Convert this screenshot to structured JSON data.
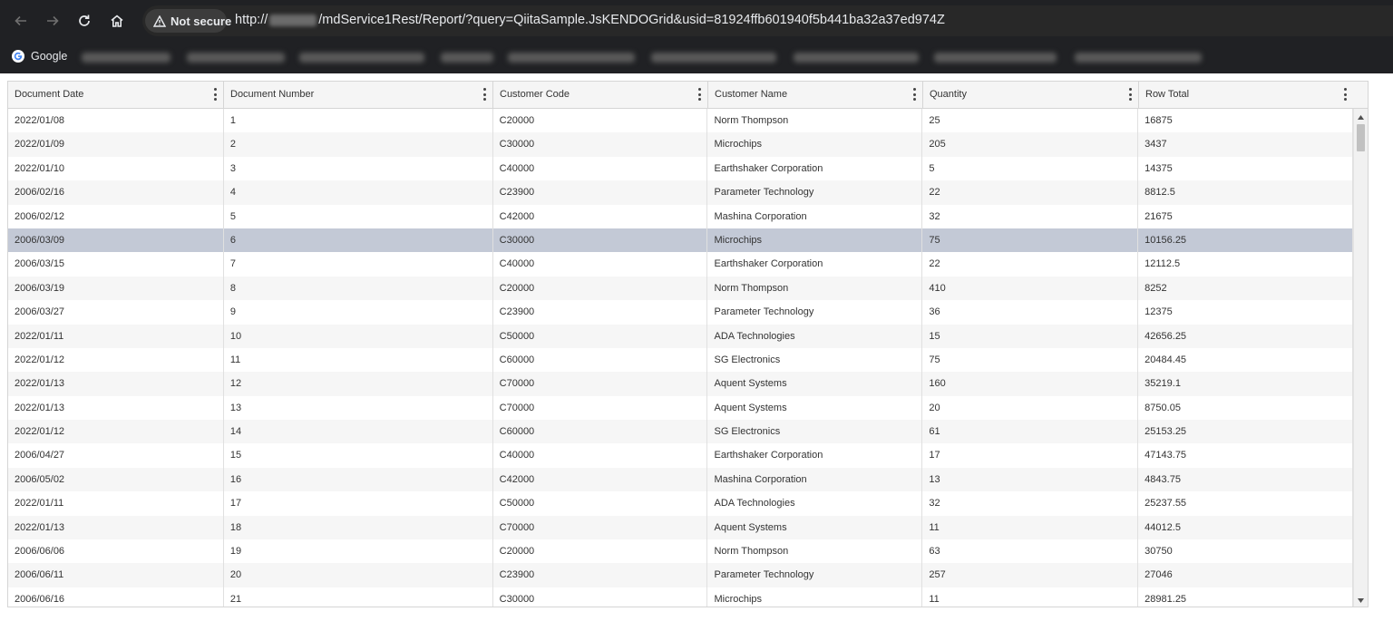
{
  "browser": {
    "security_label": "Not secure",
    "url_prefix": "http://",
    "url_suffix": "/mdService1Rest/Report/?query=QiitaSample.JsKENDOGrid&usid=81924ffb601940f5b441ba32a37ed974Z",
    "bookmark_google": "Google"
  },
  "grid": {
    "columns": [
      "Document Date",
      "Document Number",
      "Customer Code",
      "Customer Name",
      "Quantity",
      "Row Total"
    ],
    "selected_row": 6,
    "rows": [
      [
        "2022/01/08",
        "1",
        "C20000",
        "Norm Thompson",
        "25",
        "16875"
      ],
      [
        "2022/01/09",
        "2",
        "C30000",
        "Microchips",
        "205",
        "3437"
      ],
      [
        "2022/01/10",
        "3",
        "C40000",
        "Earthshaker Corporation",
        "5",
        "14375"
      ],
      [
        "2006/02/16",
        "4",
        "C23900",
        "Parameter Technology",
        "22",
        "8812.5"
      ],
      [
        "2006/02/12",
        "5",
        "C42000",
        "Mashina Corporation",
        "32",
        "21675"
      ],
      [
        "2006/03/09",
        "6",
        "C30000",
        "Microchips",
        "75",
        "10156.25"
      ],
      [
        "2006/03/15",
        "7",
        "C40000",
        "Earthshaker Corporation",
        "22",
        "12112.5"
      ],
      [
        "2006/03/19",
        "8",
        "C20000",
        "Norm Thompson",
        "410",
        "8252"
      ],
      [
        "2006/03/27",
        "9",
        "C23900",
        "Parameter Technology",
        "36",
        "12375"
      ],
      [
        "2022/01/11",
        "10",
        "C50000",
        "ADA Technologies",
        "15",
        "42656.25"
      ],
      [
        "2022/01/12",
        "11",
        "C60000",
        "SG Electronics",
        "75",
        "20484.45"
      ],
      [
        "2022/01/13",
        "12",
        "C70000",
        "Aquent Systems",
        "160",
        "35219.1"
      ],
      [
        "2022/01/13",
        "13",
        "C70000",
        "Aquent Systems",
        "20",
        "8750.05"
      ],
      [
        "2022/01/12",
        "14",
        "C60000",
        "SG Electronics",
        "61",
        "25153.25"
      ],
      [
        "2006/04/27",
        "15",
        "C40000",
        "Earthshaker Corporation",
        "17",
        "47143.75"
      ],
      [
        "2006/05/02",
        "16",
        "C42000",
        "Mashina Corporation",
        "13",
        "4843.75"
      ],
      [
        "2022/01/11",
        "17",
        "C50000",
        "ADA Technologies",
        "32",
        "25237.55"
      ],
      [
        "2022/01/13",
        "18",
        "C70000",
        "Aquent Systems",
        "11",
        "44012.5"
      ],
      [
        "2006/06/06",
        "19",
        "C20000",
        "Norm Thompson",
        "63",
        "30750"
      ],
      [
        "2006/06/11",
        "20",
        "C23900",
        "Parameter Technology",
        "257",
        "27046"
      ],
      [
        "2006/06/16",
        "21",
        "C30000",
        "Microchips",
        "11",
        "28981.25"
      ]
    ]
  }
}
